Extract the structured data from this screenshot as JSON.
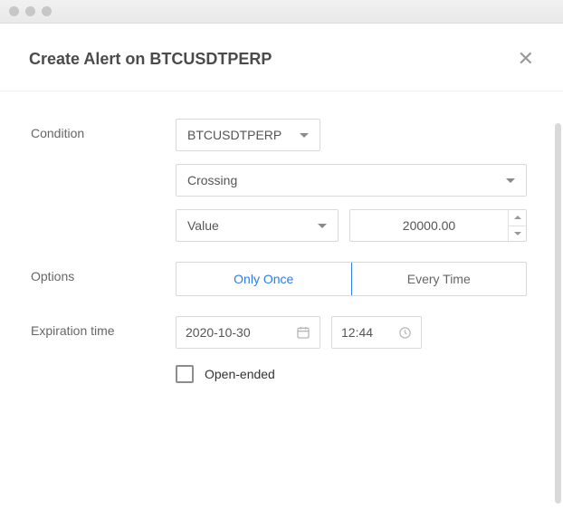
{
  "header": {
    "title": "Create Alert on BTCUSDTPERP"
  },
  "labels": {
    "condition": "Condition",
    "options": "Options",
    "expiration": "Expiration time"
  },
  "condition": {
    "symbol": "BTCUSDTPERP",
    "trigger": "Crossing",
    "valueLabel": "Value",
    "value": "20000.00"
  },
  "options": {
    "onlyOnce": "Only Once",
    "everyTime": "Every Time",
    "selected": "onlyOnce"
  },
  "expiration": {
    "date": "2020-10-30",
    "time": "12:44",
    "openEndedLabel": "Open-ended",
    "openEnded": false
  }
}
